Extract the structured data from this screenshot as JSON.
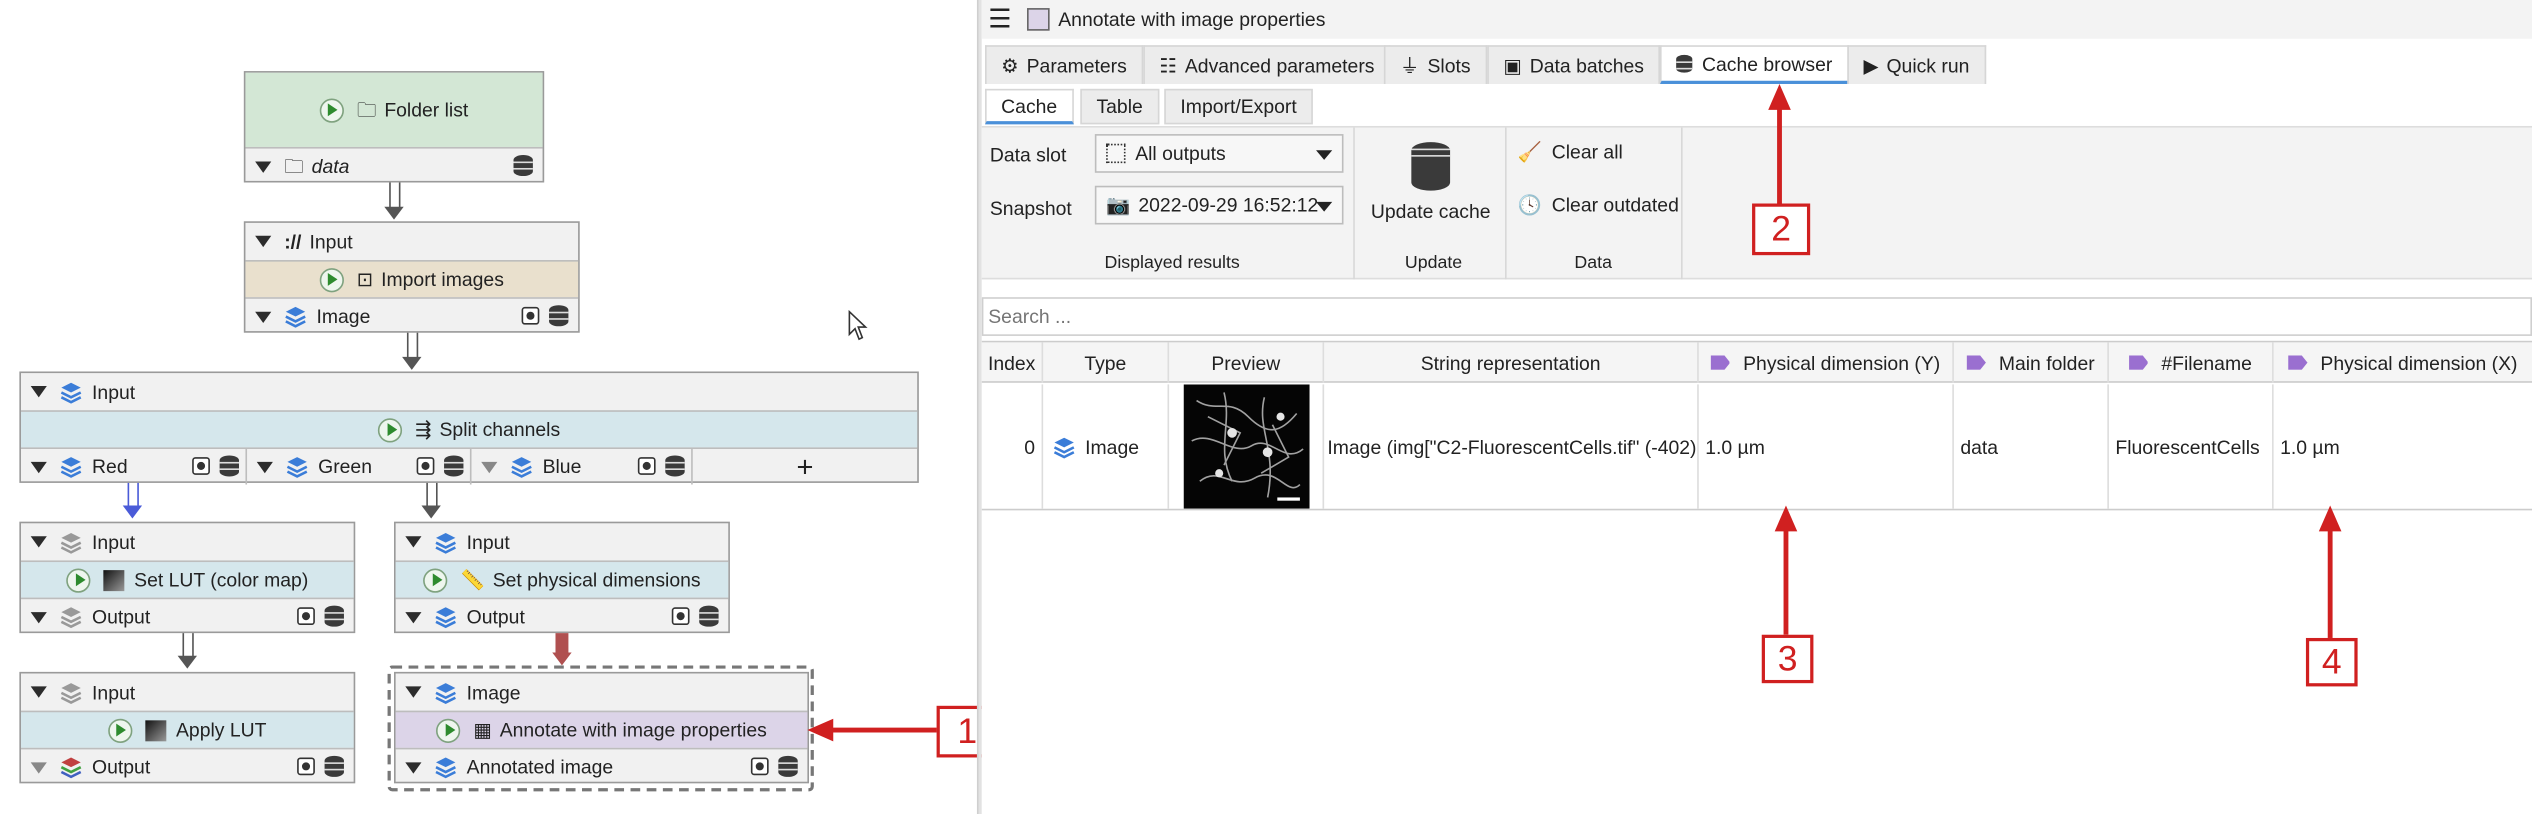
{
  "window": {
    "title": "Annotate with image properties"
  },
  "nodes": {
    "folder_list": {
      "title": "Folder list",
      "output": "data"
    },
    "import_images": {
      "input": "Input",
      "title": "Import images",
      "output": "Image",
      "input_prefix": "://"
    },
    "split_channels": {
      "input": "Input",
      "title": "Split channels",
      "outputs": [
        "Red",
        "Green",
        "Blue"
      ],
      "add_symbol": "+"
    },
    "set_lut": {
      "input": "Input",
      "title": "Set LUT (color map)",
      "output": "Output"
    },
    "set_physical": {
      "input": "Input",
      "title": "Set physical dimensions",
      "output": "Output"
    },
    "apply_lut": {
      "input": "Input",
      "title": "Apply LUT",
      "output": "Output"
    },
    "annotate": {
      "input": "Image",
      "title": "Annotate with image properties",
      "output": "Annotated image"
    }
  },
  "tabs": [
    "Parameters",
    "Advanced parameters",
    "Slots",
    "Data batches",
    "Cache browser",
    "Quick run"
  ],
  "active_tab": "Cache browser",
  "subtabs": [
    "Cache",
    "Table",
    "Import/Export"
  ],
  "toolbar": {
    "data_slot_label": "Data slot",
    "data_slot_value": "All outputs",
    "snapshot_label": "Snapshot",
    "snapshot_value": "2022-09-29 16:52:12",
    "group_displayed": "Displayed results",
    "update_cache": "Update cache",
    "group_update": "Update",
    "clear_all": "Clear all",
    "clear_outdated": "Clear outdated",
    "group_data": "Data"
  },
  "search": {
    "placeholder": "Search ..."
  },
  "table": {
    "headers": [
      "Index",
      "Type",
      "Preview",
      "String representation",
      "Physical dimension (Y)",
      "Main folder",
      "#Filename",
      "Physical dimension (X)"
    ],
    "rows": [
      {
        "index": "0",
        "type": "Image",
        "string": "Image (img[\"C2-FluorescentCells.tif\" (-402)...",
        "phys_y": "1.0 µm",
        "main_folder": "data",
        "filename": "FluorescentCells",
        "phys_x": "1.0 µm"
      }
    ]
  },
  "callouts": [
    "1",
    "2",
    "3",
    "4"
  ],
  "colors": {
    "accent": "#d02020",
    "folder_node": "#d3e7d5",
    "import_node": "#e9e0cd",
    "algo_node": "#d5e7ec",
    "annotate_node": "#dcd4e8",
    "tab_underline": "#4a90d9"
  }
}
